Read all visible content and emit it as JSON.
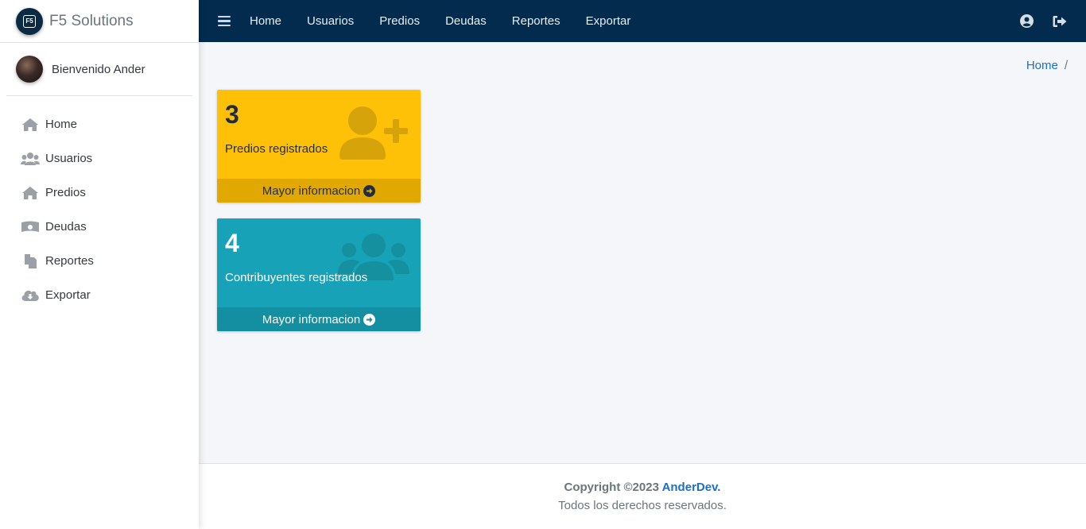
{
  "brand": {
    "name": "F5 Solutions",
    "logo_text": "F5"
  },
  "user": {
    "welcome": "Bienvenido Ander"
  },
  "sidebar": {
    "items": [
      {
        "label": "Home",
        "icon": "home-icon"
      },
      {
        "label": "Usuarios",
        "icon": "users-icon"
      },
      {
        "label": "Predios",
        "icon": "home-icon"
      },
      {
        "label": "Deudas",
        "icon": "money-icon"
      },
      {
        "label": "Reportes",
        "icon": "copy-icon"
      },
      {
        "label": "Exportar",
        "icon": "cloud-download-icon"
      }
    ]
  },
  "topnav": {
    "links": [
      "Home",
      "Usuarios",
      "Predios",
      "Deudas",
      "Reportes",
      "Exportar"
    ],
    "right_icons": [
      "user-circle-icon",
      "sign-out-icon"
    ]
  },
  "breadcrumb": {
    "home": "Home",
    "separator": "/"
  },
  "boxes": [
    {
      "count": "3",
      "label": "Predios registrados",
      "footer": "Mayor informacion",
      "color": "#ffc107",
      "icon": "user-plus-icon"
    },
    {
      "count": "4",
      "label": "Contribuyentes registrados",
      "footer": "Mayor informacion",
      "color": "#17a2b8",
      "icon": "users-icon"
    }
  ],
  "footer": {
    "copyright": "Copyright ©2023",
    "author": "AnderDev.",
    "rights": "Todos los derechos reservados."
  },
  "colors": {
    "topbar": "#032b4d",
    "accent_link": "#1b6fc8",
    "background": "#f4f6f9"
  }
}
